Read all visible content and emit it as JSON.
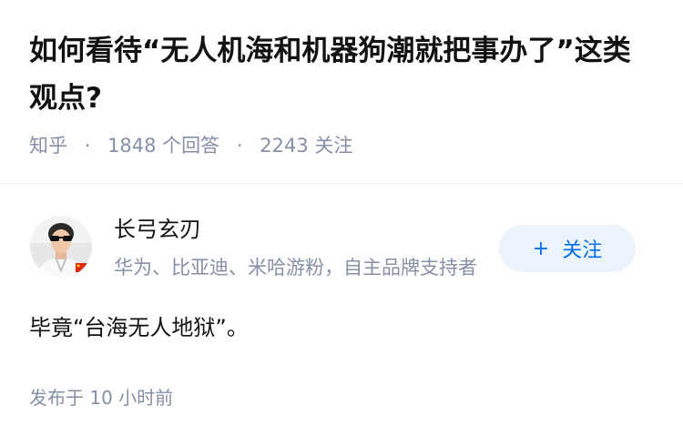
{
  "question": {
    "title": "如何看待“无人机海和机器狗潮就把事办了”这类观点?",
    "source": "知乎",
    "answer_count": "1848 个回答",
    "follower_count": "2243 关注"
  },
  "author": {
    "name": "长弓玄刃",
    "bio": "华为、比亚迪、米哈游粉，自主品牌支持者",
    "follow_label": "关注",
    "follow_icon": "plus-icon"
  },
  "answer": {
    "content": "毕竟“台海无人地狱”。",
    "published": "发布于  10 小时前"
  },
  "colors": {
    "title": "#121212",
    "meta": "#8590a6",
    "accent": "#056de8",
    "follow_bg": "#ebf4fc"
  }
}
